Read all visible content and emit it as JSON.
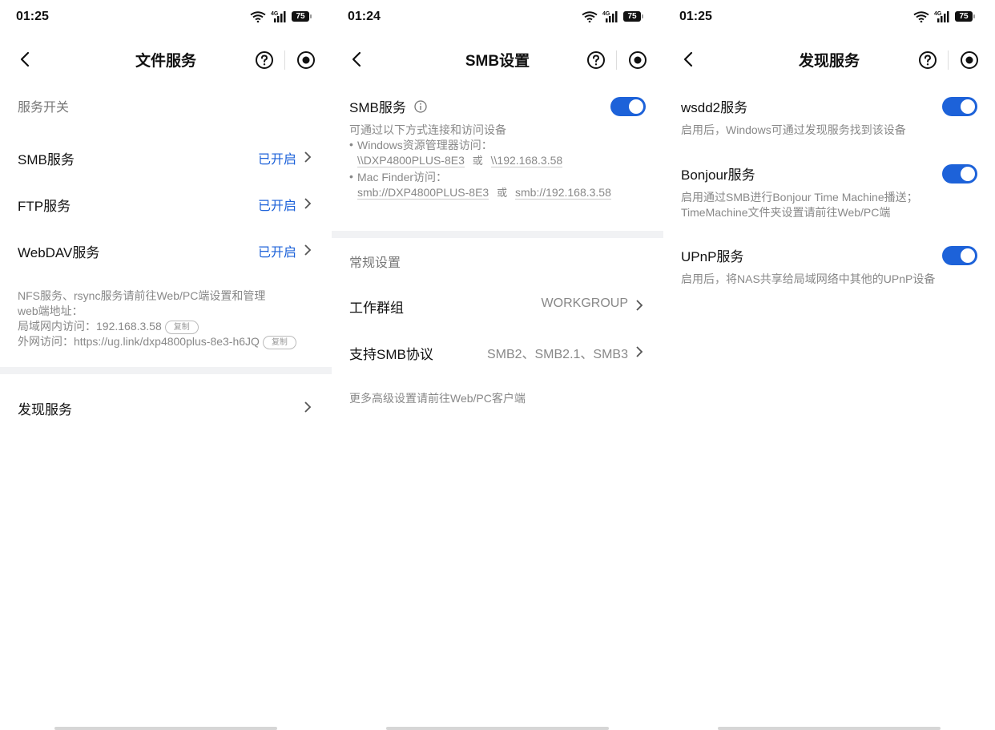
{
  "screen1": {
    "time": "01:25",
    "battery": "75",
    "title": "文件服务",
    "section_label": "服务开关",
    "rows": [
      {
        "label": "SMB服务",
        "value": "已开启"
      },
      {
        "label": "FTP服务",
        "value": "已开启"
      },
      {
        "label": "WebDAV服务",
        "value": "已开启"
      }
    ],
    "note_line1": "NFS服务、rsync服务请前往Web/PC端设置和管理",
    "note_line2": "web端地址：",
    "lan_label": "局域网内访问：",
    "lan_value": "192.168.3.58",
    "wan_label": "外网访问：",
    "wan_value": "https://ug.link/dxp4800plus-8e3-h6JQ",
    "copy_label": "复制",
    "discovery_label": "发现服务"
  },
  "screen2": {
    "time": "01:24",
    "battery": "75",
    "title": "SMB设置",
    "smb_service_label": "SMB服务",
    "smb_desc": "可通过以下方式连接和访问设备",
    "windows_label": "Windows资源管理器访问：",
    "windows_path1": "\\\\DXP4800PLUS-8E3",
    "or_label": "或",
    "windows_path2": "\\\\192.168.3.58",
    "mac_label": "Mac Finder访问：",
    "mac_path1": "smb://DXP4800PLUS-8E3",
    "mac_path2": "smb://192.168.3.58",
    "general_label": "常规设置",
    "workgroup_label": "工作群组",
    "workgroup_value": "WORKGROUP",
    "protocol_label": "支持SMB协议",
    "protocol_value": "SMB2、SMB2.1、SMB3",
    "more_note": "更多高级设置请前往Web/PC客户端"
  },
  "screen3": {
    "time": "01:25",
    "battery": "75",
    "title": "发现服务",
    "items": [
      {
        "title": "wsdd2服务",
        "desc1": "启用后，Windows可通过发现服务找到该设备",
        "desc2": ""
      },
      {
        "title": "Bonjour服务",
        "desc1": "启用通过SMB进行Bonjour Time Machine播送；",
        "desc2": "TimeMachine文件夹设置请前往Web/PC端"
      },
      {
        "title": "UPnP服务",
        "desc1": "启用后，将NAS共享给局域网络中其他的UPnP设备",
        "desc2": ""
      }
    ]
  },
  "colors": {
    "accent": "#1d62d9",
    "muted": "#888888",
    "band": "#f1f2f4"
  },
  "icons": [
    "wifi-icon",
    "signal-4g-icon",
    "battery-icon",
    "back-arrow-icon",
    "help-circle-icon",
    "record-icon",
    "chevron-right-icon",
    "info-icon"
  ]
}
